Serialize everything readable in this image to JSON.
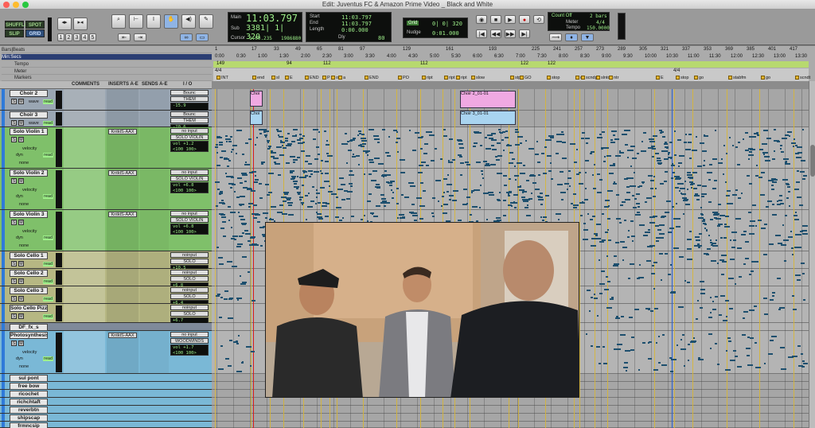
{
  "window": {
    "title": "Edit: Juventus FC & Amazon Prime Video _ Black and White"
  },
  "toolbar": {
    "modes": [
      "SHUFFLE",
      "SPOT",
      "SLIP",
      "GRID"
    ],
    "zoom_presets": [
      "1",
      "2",
      "3",
      "4",
      "5"
    ],
    "main_counter": {
      "main_label": "Main",
      "main_value": "11:03.797",
      "sub_label": "Sub",
      "sub_value": "3381| 1| 320",
      "cursor_label": "Cursor",
      "cursor_value": "1:00.235",
      "sample_value": "1986880"
    },
    "selection": {
      "start_label": "Start",
      "start_value": "11:03.797",
      "end_label": "End",
      "end_value": "11:03.797",
      "length_label": "Length",
      "length_value": "0:00.000",
      "dly_label": "Dly",
      "number": "80"
    },
    "grid_nudge": {
      "grid_label": "Grid",
      "grid_value": "0| 0| 320",
      "nudge_label": "Nudge",
      "nudge_value": "0:01.000"
    },
    "count": {
      "title": "Count Off",
      "bars": "2 bars",
      "meter_label": "Meter",
      "meter_value": "4/4",
      "tempo_label": "Tempo",
      "tempo_value": "150.0000"
    }
  },
  "rulers": {
    "names": [
      "Bars|Beats",
      "Min:Secs",
      "Tempo",
      "Meter",
      "Markers"
    ],
    "bars": [
      "1",
      "17",
      "33",
      "49",
      "65",
      "81",
      "97",
      "129",
      "161",
      "193",
      "225",
      "241",
      "257",
      "273",
      "289",
      "305",
      "321",
      "337",
      "353",
      "369",
      "385",
      "401",
      "417"
    ],
    "mins": [
      "0:00",
      "0:30",
      "1:00",
      "1:30",
      "2:00",
      "2:30",
      "3:00",
      "3:30",
      "4:00",
      "4:30",
      "5:00",
      "5:30",
      "6:00",
      "6:30",
      "7:00",
      "7:30",
      "8:00",
      "8:30",
      "9:00",
      "9:30",
      "10:00",
      "10:30",
      "11:00",
      "11:30",
      "12:00",
      "12:30",
      "13:00",
      "13:30"
    ],
    "tempos": [
      "149",
      "94",
      "112",
      "112",
      "122",
      "122"
    ],
    "meters": [
      "4/4",
      "4/4"
    ],
    "markers": [
      "INT",
      "end",
      "sl",
      "E",
      "END",
      "P",
      "or",
      "a",
      "END",
      "PO",
      "ript",
      "ript",
      "ript",
      "slow",
      "stps",
      "GO",
      "stop",
      "dg",
      "scndpt",
      "slntdc",
      "ntr",
      "E",
      "stop",
      "go",
      "stabfm",
      "go",
      "scndt"
    ]
  },
  "columns": [
    "COMMENTS",
    "INSERTS A-E",
    "SENDS A-E",
    "I / O"
  ],
  "tracks": [
    {
      "name": "Choir 2",
      "type": "audio",
      "mode": "wave",
      "read": "read",
      "io": "Bounc",
      "out": "THEM",
      "vol": "-15.9"
    },
    {
      "name": "Choir 3",
      "type": "audio",
      "mode": "wave",
      "read": "read",
      "io": "Bounc",
      "out": "THEM",
      "vol": "-20.6"
    },
    {
      "name": "Solo Violin 1",
      "type": "inst",
      "plugin": "KntktS-AAX",
      "in": "no input",
      "out": "SOLO VIOLIN",
      "vol": "vol +1.2",
      "pan": "<100 100>",
      "velocity": "velocity",
      "dyn": "dyn",
      "read": "read",
      "none": "none"
    },
    {
      "name": "Solo Violin 2",
      "type": "inst",
      "plugin": "KntktS-AAX",
      "in": "no input",
      "out": "SOLO VIOLIN",
      "vol": "vol +6.8",
      "pan": "<100 100>",
      "velocity": "velocity",
      "dyn": "dyn",
      "read": "read",
      "none": "none"
    },
    {
      "name": "Solo Violin 3",
      "type": "inst",
      "plugin": "KntktS-AAX",
      "in": "no input",
      "out": "SOLO VIOLIN",
      "vol": "vol +6.8",
      "pan": "<100 100>",
      "velocity": "velocity",
      "dyn": "dyn",
      "read": "read",
      "none": "none"
    },
    {
      "name": "Solo Cello 1",
      "type": "aux",
      "in": "noinput",
      "out": "SOLO",
      "vol": "+10.5",
      "read": "read"
    },
    {
      "name": "Solo Cello 2",
      "type": "aux",
      "in": "noinput",
      "out": "SOLO",
      "vol": "+6.8",
      "read": "read"
    },
    {
      "name": "Solo Cello 3",
      "type": "aux",
      "in": "noinput",
      "out": "SOLO",
      "vol": "+6.4",
      "read": "read"
    },
    {
      "name": "Solo Cello Pizz",
      "type": "aux",
      "in": "noinput",
      "out": "SOLO",
      "vol": "+6.7",
      "read": "read"
    },
    {
      "name": "DF_fx_s",
      "type": "folder"
    },
    {
      "name": "Photosynthesis",
      "type": "inst",
      "plugin": "KntktS-AAX",
      "in": "no input",
      "out": "WOODWINDS",
      "vol": "vol +1.7",
      "pan": "<100 100>",
      "velocity": "velocity",
      "dyn": "dyn",
      "read": "read",
      "none": "none"
    },
    {
      "name": "sul pont",
      "type": "small"
    },
    {
      "name": "free bow",
      "type": "small"
    },
    {
      "name": "ricochet",
      "type": "small"
    },
    {
      "name": "richchtaft",
      "type": "small"
    },
    {
      "name": "reverbtn",
      "type": "small"
    },
    {
      "name": "shipscap",
      "type": "small"
    },
    {
      "name": "frmncsip",
      "type": "small"
    }
  ],
  "clips": [
    {
      "label": "Choi",
      "color": "#f0a9e2"
    },
    {
      "label": "Choi",
      "color": "#a9d4f0"
    },
    {
      "label": "Choir 2_01-01",
      "color": "#f0a9e2"
    },
    {
      "label": "Choir 3_01-01",
      "color": "#a9d4f0"
    }
  ],
  "colors": {
    "green_track": "#7fc06a",
    "olive_track": "#b6b783",
    "blue_track": "#7ab8d6",
    "lcd_text": "#9ef08a",
    "marker": "#e3b42b",
    "notes": "#1d4f6e"
  },
  "icons": [
    "zoom-icon",
    "trim-icon",
    "selector-icon",
    "grabber-icon",
    "scrubber-icon",
    "pencil-icon",
    "speaker-icon",
    "play-icon",
    "stop-icon",
    "rewind-icon",
    "forward-icon",
    "record-icon",
    "loop-icon",
    "link-icon"
  ]
}
